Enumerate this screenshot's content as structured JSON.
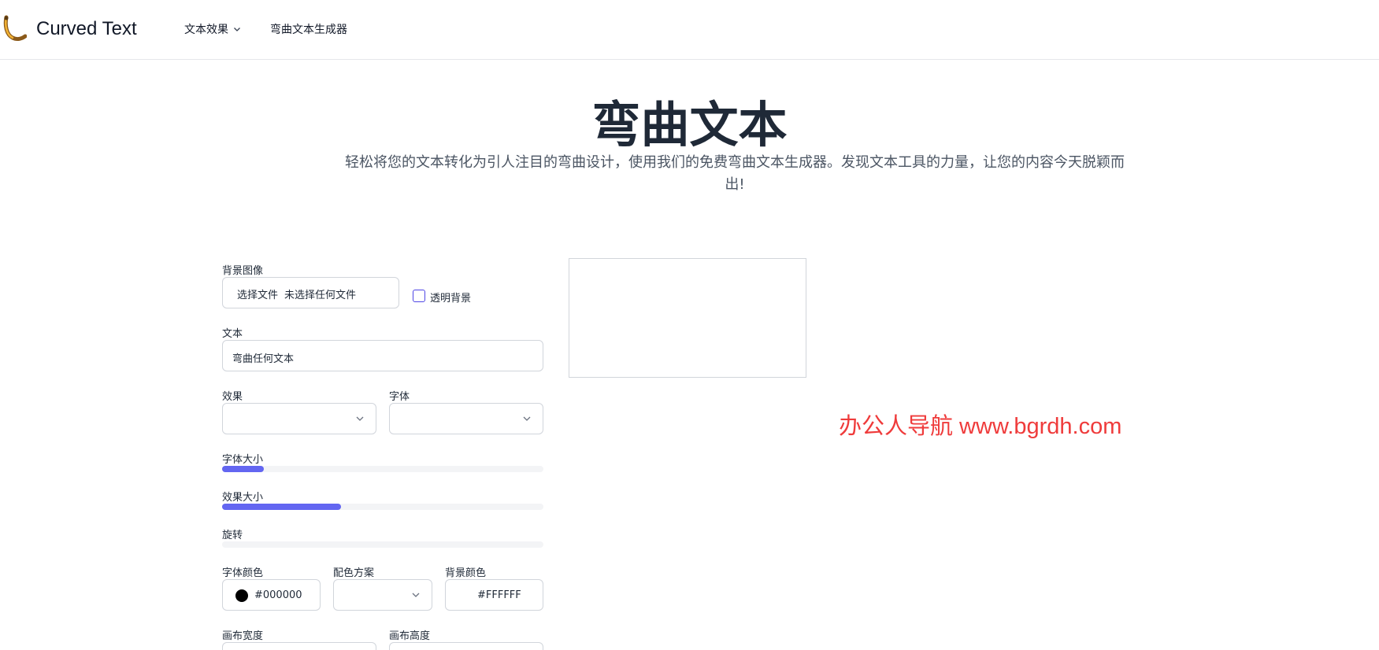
{
  "header": {
    "brand": "Curved Text",
    "nav": [
      {
        "label": "文本效果"
      },
      {
        "label": "弯曲文本生成器"
      }
    ]
  },
  "hero": {
    "title": "弯曲文本",
    "subtitle_line1": "轻松将您的文本转化为引人注目的弯曲设计，使用我们的免费弯曲文本生成器。发现文本工具的力量，让您的内容今天脱颖而",
    "subtitle_line2": "出!"
  },
  "form": {
    "bg_image_label": "背景图像",
    "file_button": "选择文件",
    "file_status": "未选择任何文件",
    "transparent_label": "透明背景",
    "transparent_checked": false,
    "text_label": "文本",
    "text_value": "弯曲任何文本",
    "effect_label": "效果",
    "effect_value": "",
    "font_label": "字体",
    "font_value": "",
    "font_size_label": "字体大小",
    "font_size_level": 0.13,
    "effect_size_label": "效果大小",
    "effect_size_level": 0.37,
    "rotate_label": "旋转",
    "rotate_level": 0,
    "font_color_label": "字体颜色",
    "font_color_value": "#000000",
    "scheme_label": "配色方案",
    "scheme_value": "",
    "bg_color_label": "背景颜色",
    "bg_color_value": "#FFFFFF",
    "canvas_width_label": "画布宽度",
    "canvas_height_label": "画布高度"
  },
  "watermark": "办公人导航  www.bgrdh.com",
  "colors": {
    "accent": "#6366f1",
    "checkbox_border": "#4f46e5",
    "watermark": "#ef3b3b"
  }
}
